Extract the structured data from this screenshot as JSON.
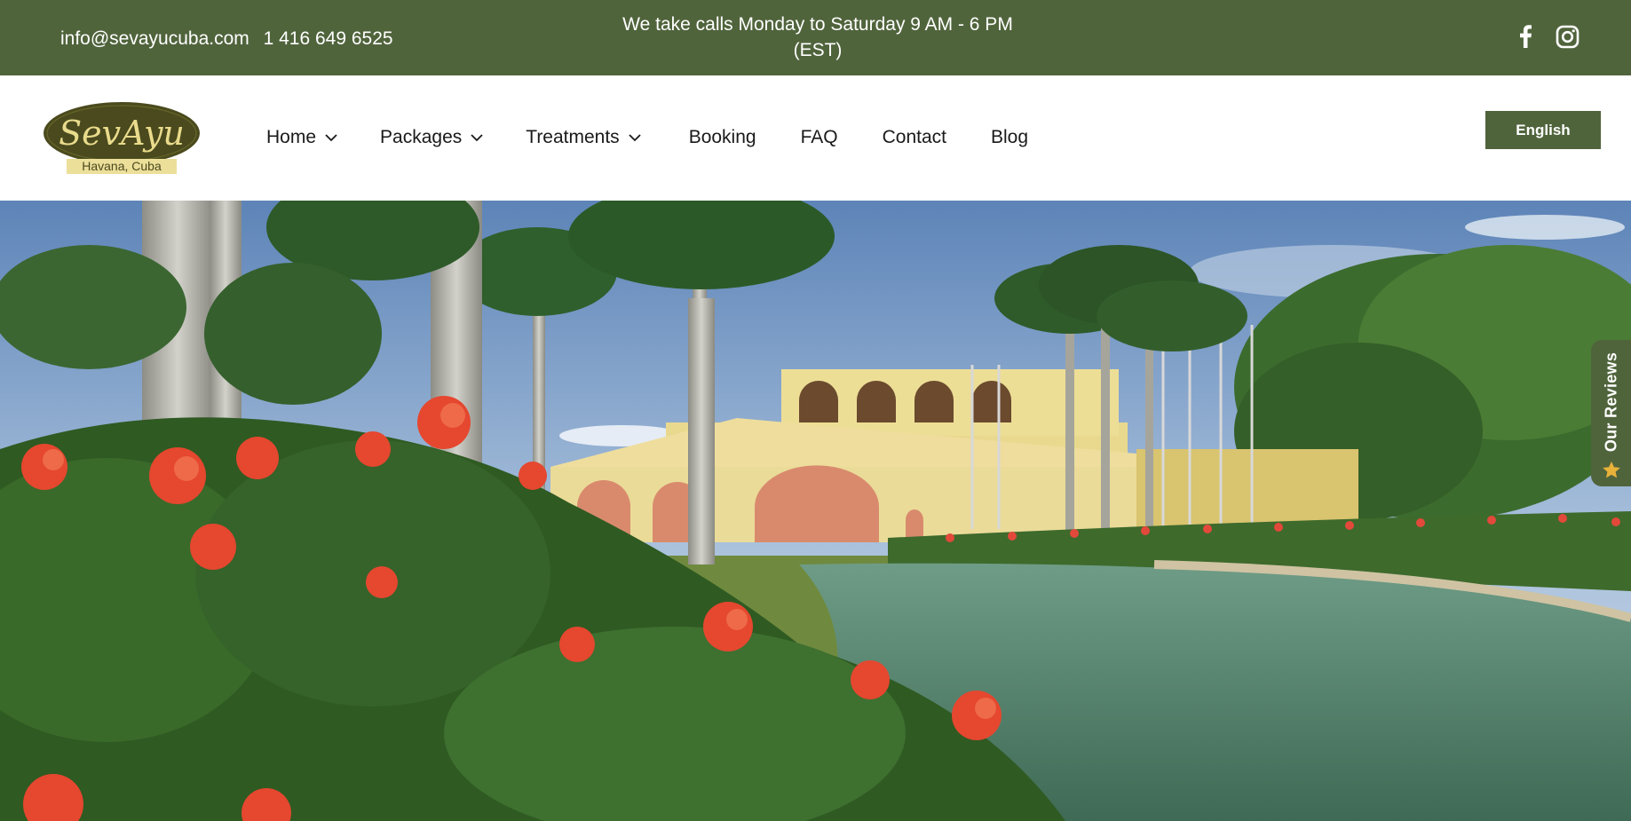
{
  "topbar": {
    "email": "info@sevayucuba.com",
    "phone": "1 416 649 6525",
    "hours": "We take calls Monday to Saturday 9 AM - 6 PM (EST)",
    "social": [
      "facebook-icon",
      "instagram-icon"
    ]
  },
  "logo": {
    "brand": "SevAyu",
    "tagline": "Havana, Cuba"
  },
  "nav": {
    "home": "Home",
    "packages": "Packages",
    "treatments": "Treatments",
    "booking": "Booking",
    "faq": "FAQ",
    "contact": "Contact",
    "blog": "Blog"
  },
  "language": {
    "selected": "English"
  },
  "reviews_tab": {
    "label": "Our Reviews",
    "icon": "star-icon"
  },
  "colors": {
    "brand_green": "#50643c",
    "text": "#1a1a1a",
    "star": "#e8b23a"
  }
}
